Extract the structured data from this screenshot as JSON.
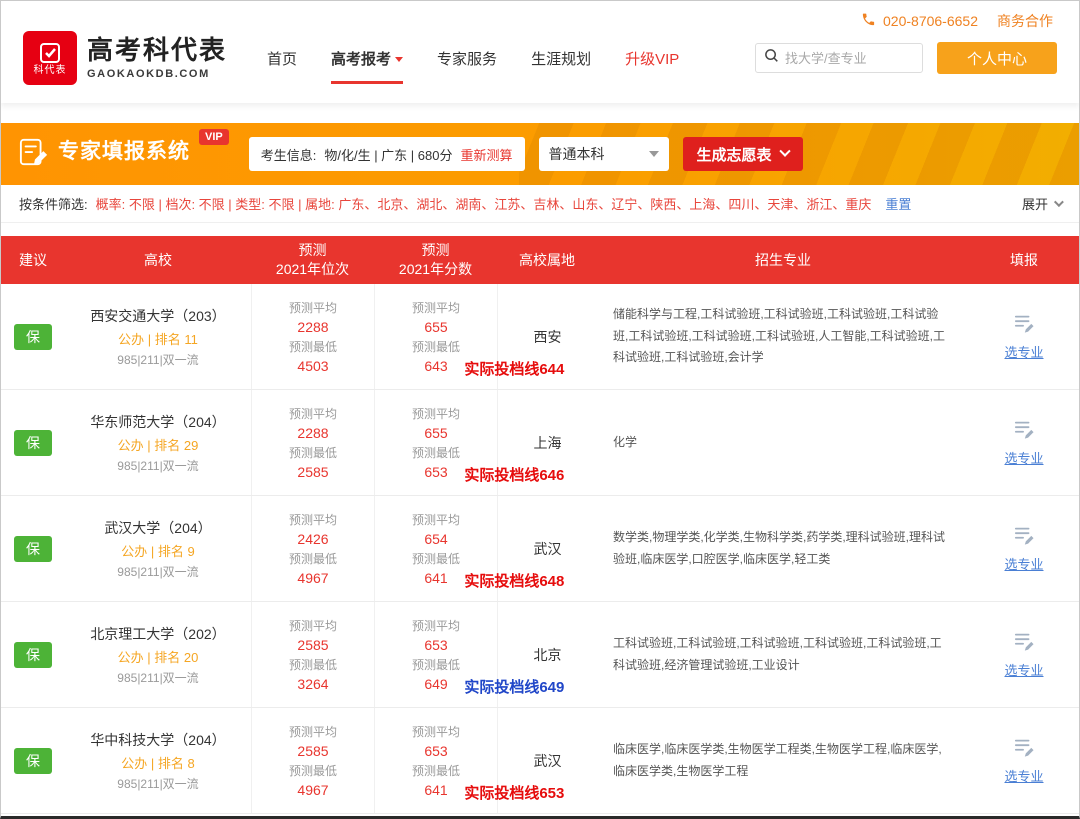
{
  "colors": {
    "brand_red": "#e8352e",
    "logo_red": "#e60012",
    "banner_orange": "#ff9402",
    "badge_green": "#4db337",
    "link_blue": "#4a7fd4",
    "accent_orange": "#f5a623",
    "personal_center_orange": "#f7a21b",
    "actual_line_red": "#e60c0c",
    "actual_line_blue": "#2046c8"
  },
  "icons": {
    "phone": "☎",
    "search": "🔍",
    "caret_down": "▼",
    "chevron_down": "∨",
    "edit_document": "✎"
  },
  "topbar": {
    "phone": "020-8706-6652",
    "business_link": "商务合作",
    "logo": {
      "badge": "科代表",
      "title": "高考科代表",
      "domain": "GAOKAOKDB.COM"
    },
    "nav": {
      "home": "首页",
      "apply": "高考报考",
      "expert": "专家服务",
      "career": "生涯规划",
      "vip": "升级VIP"
    },
    "search_placeholder": "找大学/查专业",
    "personal_center": "个人中心"
  },
  "banner": {
    "title": "专家填报系统",
    "vip_badge": "VIP",
    "candidate_label": "考生信息:",
    "candidate_info": "物/化/生 | 广东 | 680分",
    "recalculate": "重新测算",
    "batch": "普通本科",
    "generate": "生成志愿表"
  },
  "filter": {
    "label": "按条件筛选:",
    "criteria": "概率: 不限 | 档次: 不限 | 类型: 不限 | 属地: 广东、北京、湖北、湖南、江苏、吉林、山东、辽宁、陕西、上海、四川、天津、浙江、重庆",
    "reset": "重置",
    "expand": "展开"
  },
  "table": {
    "headers": [
      {
        "l1": "建议",
        "l2": ""
      },
      {
        "l1": "高校",
        "l2": ""
      },
      {
        "l1": "预测",
        "l2": "2021年位次"
      },
      {
        "l1": "预测",
        "l2": "2021年分数"
      },
      {
        "l1": "高校属地",
        "l2": ""
      },
      {
        "l1": "招生专业",
        "l2": ""
      },
      {
        "l1": "填报",
        "l2": ""
      }
    ],
    "labels": {
      "avg": "预测平均",
      "min": "预测最低",
      "action": "选专业"
    },
    "rows": [
      {
        "suggest": "保",
        "school": "西安交通大学（203）",
        "meta": "公办 | 排名 11",
        "tags": "985|211|双一流",
        "rank_avg": "2288",
        "rank_min": "4503",
        "score_avg": "655",
        "score_min": "643",
        "actual": "实际投档线644",
        "city": "西安",
        "majors": "储能科学与工程,工科试验班,工科试验班,工科试验班,工科试验班,工科试验班,工科试验班,工科试验班,人工智能,工科试验班,工科试验班,工科试验班,会计学"
      },
      {
        "suggest": "保",
        "school": "华东师范大学（204）",
        "meta": "公办 | 排名 29",
        "tags": "985|211|双一流",
        "rank_avg": "2288",
        "rank_min": "2585",
        "score_avg": "655",
        "score_min": "653",
        "actual": "实际投档线646",
        "city": "上海",
        "majors": "化学"
      },
      {
        "suggest": "保",
        "school": "武汉大学（204）",
        "meta": "公办 | 排名 9",
        "tags": "985|211|双一流",
        "rank_avg": "2426",
        "rank_min": "4967",
        "score_avg": "654",
        "score_min": "641",
        "actual": "实际投档线648",
        "city": "武汉",
        "majors": "数学类,物理学类,化学类,生物科学类,药学类,理科试验班,理科试验班,临床医学,口腔医学,临床医学,轻工类"
      },
      {
        "suggest": "保",
        "school": "北京理工大学（202）",
        "meta": "公办 | 排名 20",
        "tags": "985|211|双一流",
        "rank_avg": "2585",
        "rank_min": "3264",
        "score_avg": "653",
        "score_min": "649",
        "actual": "实际投档线649",
        "city": "北京",
        "majors": "工科试验班,工科试验班,工科试验班,工科试验班,工科试验班,工科试验班,经济管理试验班,工业设计"
      },
      {
        "suggest": "保",
        "school": "华中科技大学（204）",
        "meta": "公办 | 排名 8",
        "tags": "985|211|双一流",
        "rank_avg": "2585",
        "rank_min": "4967",
        "score_avg": "653",
        "score_min": "641",
        "actual": "实际投档线653",
        "city": "武汉",
        "majors": "临床医学,临床医学类,生物医学工程类,生物医学工程,临床医学,临床医学类,生物医学工程"
      }
    ]
  }
}
